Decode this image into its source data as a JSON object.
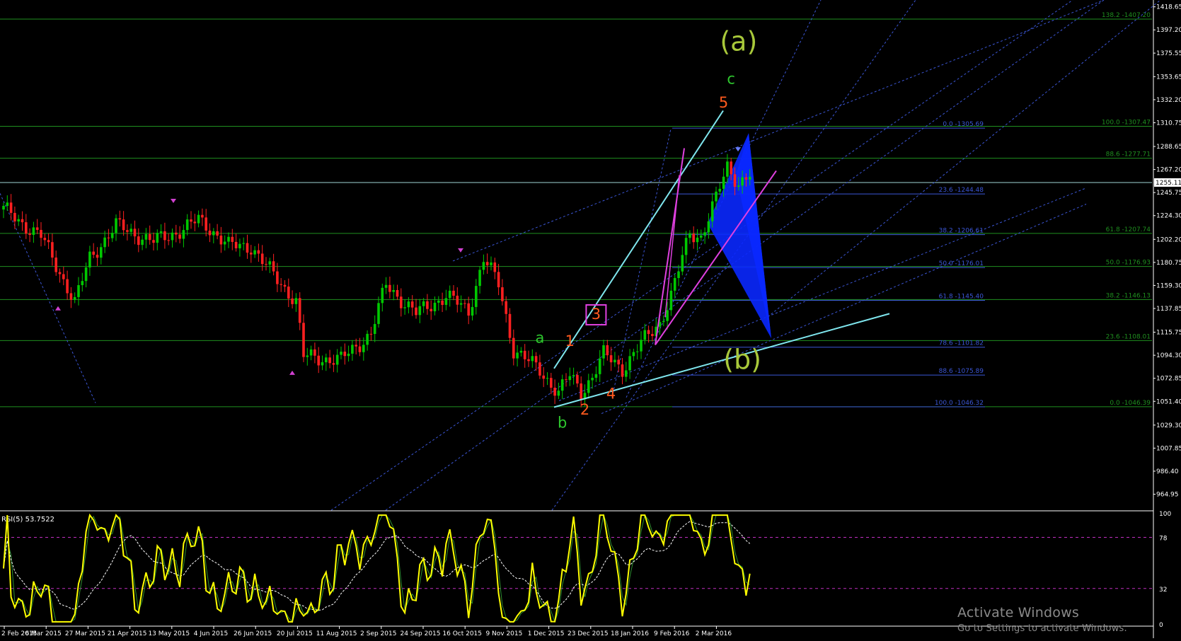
{
  "chart_data": {
    "type": "candlestick",
    "symbol_price": "1255.11",
    "price_axis": {
      "ylim": [
        949.5,
        1425
      ],
      "ticks": [
        "1418.65",
        "1397.20",
        "1375.55",
        "1353.65",
        "1332.20",
        "1310.75",
        "1288.65",
        "1267.20",
        "1245.75",
        "1224.30",
        "1202.20",
        "1180.75",
        "1159.30",
        "1137.85",
        "1115.75",
        "1094.30",
        "1072.85",
        "1051.40",
        "1029.30",
        "1007.85",
        "986.40",
        "964.95"
      ]
    },
    "time_axis": {
      "labels": [
        "2 Feb 2015",
        "6 Mar 2015",
        "27 Mar 2015",
        "21 Apr 2015",
        "13 May 2015",
        "4 Jun 2015",
        "26 Jun 2015",
        "20 Jul 2015",
        "11 Aug 2015",
        "2 Sep 2015",
        "24 Sep 2015",
        "16 Oct 2015",
        "9 Nov 2015",
        "1 Dec 2015",
        "23 Dec 2015",
        "18 Jan 2016",
        "9 Feb 2016",
        "2 Mar 2016"
      ]
    },
    "horizontal_levels": [
      {
        "price": 1407.2,
        "color": "#1f8f1f",
        "label": "138.2 -1407.20",
        "label_side": "right"
      },
      {
        "price": 1307.47,
        "color": "#1f8f1f",
        "label": "100.0 -1307.47",
        "label_side": "right"
      },
      {
        "price": 1277.71,
        "color": "#1f8f1f",
        "label": "88.6 -1277.71",
        "label_side": "right"
      },
      {
        "price": 1255.11,
        "color": "#9fd4d4",
        "label": "",
        "label_side": "right"
      },
      {
        "price": 1207.74,
        "color": "#1f8f1f",
        "label": "61.8 -1207.74",
        "label_side": "right"
      },
      {
        "price": 1176.93,
        "color": "#1f8f1f",
        "label": "50.0 -1176.93",
        "label_side": "right"
      },
      {
        "price": 1146.13,
        "color": "#1f8f1f",
        "label": "38.2 -1146.13",
        "label_side": "right"
      },
      {
        "price": 1108.01,
        "color": "#1f8f1f",
        "label": "23.6 -1108.01",
        "label_side": "right"
      },
      {
        "price": 1046.39,
        "color": "#1f8f1f",
        "label": "0.0 -1046.39",
        "label_side": "right"
      },
      {
        "price": 1305.69,
        "color": "#3b56d6",
        "label": "0.0 -1305.69",
        "label_side": "mid"
      },
      {
        "price": 1244.48,
        "color": "#3b56d6",
        "label": "23.6 -1244.48",
        "label_side": "mid"
      },
      {
        "price": 1206.61,
        "color": "#3b56d6",
        "label": "38.2 -1206.61",
        "label_side": "mid"
      },
      {
        "price": 1176.01,
        "color": "#3b56d6",
        "label": "50.0 -1176.01",
        "label_side": "mid"
      },
      {
        "price": 1145.4,
        "color": "#3b56d6",
        "label": "61.8 -1145.40",
        "label_side": "mid"
      },
      {
        "price": 1101.82,
        "color": "#3b56d6",
        "label": "78.6 -1101.82",
        "label_side": "mid"
      },
      {
        "price": 1075.89,
        "color": "#3b56d6",
        "label": "88.6 -1075.89",
        "label_side": "mid"
      },
      {
        "price": 1046.32,
        "color": "#3b56d6",
        "label": "100.0 -1046.32",
        "label_side": "mid"
      }
    ],
    "wave_labels": [
      {
        "text": "(a)",
        "color": "#a8c83a",
        "bar": 196,
        "price": 1378
      },
      {
        "text": "(b)",
        "color": "#a8c83a",
        "bar": 197,
        "price": 1082
      },
      {
        "text": "c",
        "color": "#2ec82e",
        "bar": 194,
        "price": 1347
      },
      {
        "text": "a",
        "color": "#2ec82e",
        "bar": 143,
        "price": 1106
      },
      {
        "text": "b",
        "color": "#2ec82e",
        "bar": 149,
        "price": 1027
      },
      {
        "text": "1",
        "color": "#ff5a1e",
        "bar": 151,
        "price": 1103
      },
      {
        "text": "2",
        "color": "#ff5a1e",
        "bar": 155,
        "price": 1039
      },
      {
        "text": "4",
        "color": "#ff5a1e",
        "bar": 162,
        "price": 1054
      },
      {
        "text": "5",
        "color": "#ff5a1e",
        "bar": 192,
        "price": 1325
      },
      {
        "text": "3",
        "color": "#ff5a1e",
        "bar": 158,
        "price": 1128,
        "boxed": true
      }
    ],
    "rsi": {
      "label": "RSI(5) 53.7522",
      "ticks": [
        "100",
        "78",
        "32",
        "0"
      ],
      "levels": [
        78,
        32
      ]
    },
    "watermark": {
      "title": "Activate Windows",
      "subtitle": "Go to Settings to activate Windows."
    },
    "colors": {
      "background": "#000000",
      "bull_candle": "#00c800",
      "bear_candle": "#ff2020",
      "rsi_line": "#ffff00",
      "rsi_ma": "#ffffff",
      "channel_blue": "#3b56d6",
      "trend_cyan": "#7fe6ee",
      "magenta": "#e040e0",
      "pattern_fill": "#0a28ff"
    }
  }
}
